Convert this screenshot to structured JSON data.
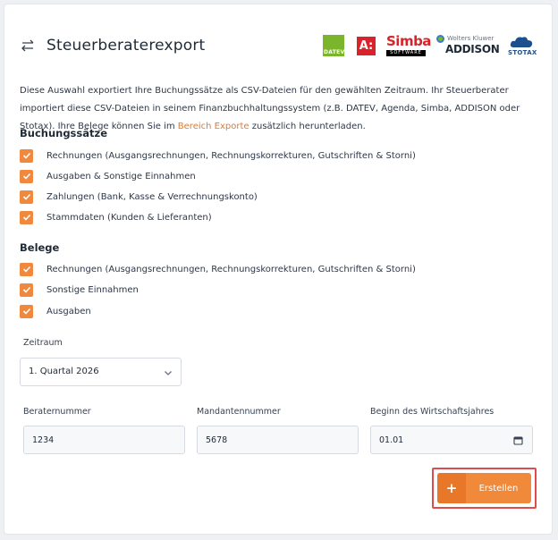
{
  "header": {
    "title": "Steuerberaterexport",
    "logos": {
      "datev": "DATEV",
      "agenda": "A:",
      "simba": "Simba",
      "simba_sub": "SOFTWARE",
      "wolters_kluwer": "Wolters Kluwer",
      "addison": "ADDISON",
      "stotax": "STOTAX"
    }
  },
  "description": {
    "part1": "Diese Auswahl exportiert Ihre Buchungssätze als CSV-Dateien für den gewählten Zeitraum. Ihr Steuerberater importiert diese CSV-Dateien in seinem Finanzbuchhaltungssystem (z.B. DATEV, Agenda, Simba, ADDISON oder Stotax). Ihre Belege können Sie im ",
    "link": "Bereich Exporte",
    "part2": " zusätzlich herunterladen."
  },
  "buchungssaetze": {
    "title": "Buchungssätze",
    "items": [
      {
        "label": "Rechnungen (Ausgangsrechnungen, Rechnungskorrekturen, Gutschriften & Storni)",
        "checked": true
      },
      {
        "label": "Ausgaben & Sonstige Einnahmen",
        "checked": true
      },
      {
        "label": "Zahlungen (Bank, Kasse & Verrechnungskonto)",
        "checked": true
      },
      {
        "label": "Stammdaten (Kunden & Lieferanten)",
        "checked": true
      }
    ]
  },
  "belege": {
    "title": "Belege",
    "items": [
      {
        "label": "Rechnungen (Ausgangsrechnungen, Rechnungskorrekturen, Gutschriften & Storni)",
        "checked": true
      },
      {
        "label": "Sonstige Einnahmen",
        "checked": true
      },
      {
        "label": "Ausgaben",
        "checked": true
      }
    ]
  },
  "zeitraum": {
    "label": "Zeitraum",
    "value": "1. Quartal 2026"
  },
  "beraternummer": {
    "label": "Beraternummer",
    "value": "1234"
  },
  "mandantennummer": {
    "label": "Mandantennummer",
    "value": "5678"
  },
  "wirtschaftsjahr": {
    "label": "Beginn des Wirtschaftsjahres",
    "value": "01.01"
  },
  "actions": {
    "create_label": "Erstellen",
    "create_icon": "+"
  },
  "colors": {
    "accent": "#f0883e",
    "accent_dark": "#e9772a",
    "link": "#e8782a",
    "highlight": "#e04b4b"
  }
}
